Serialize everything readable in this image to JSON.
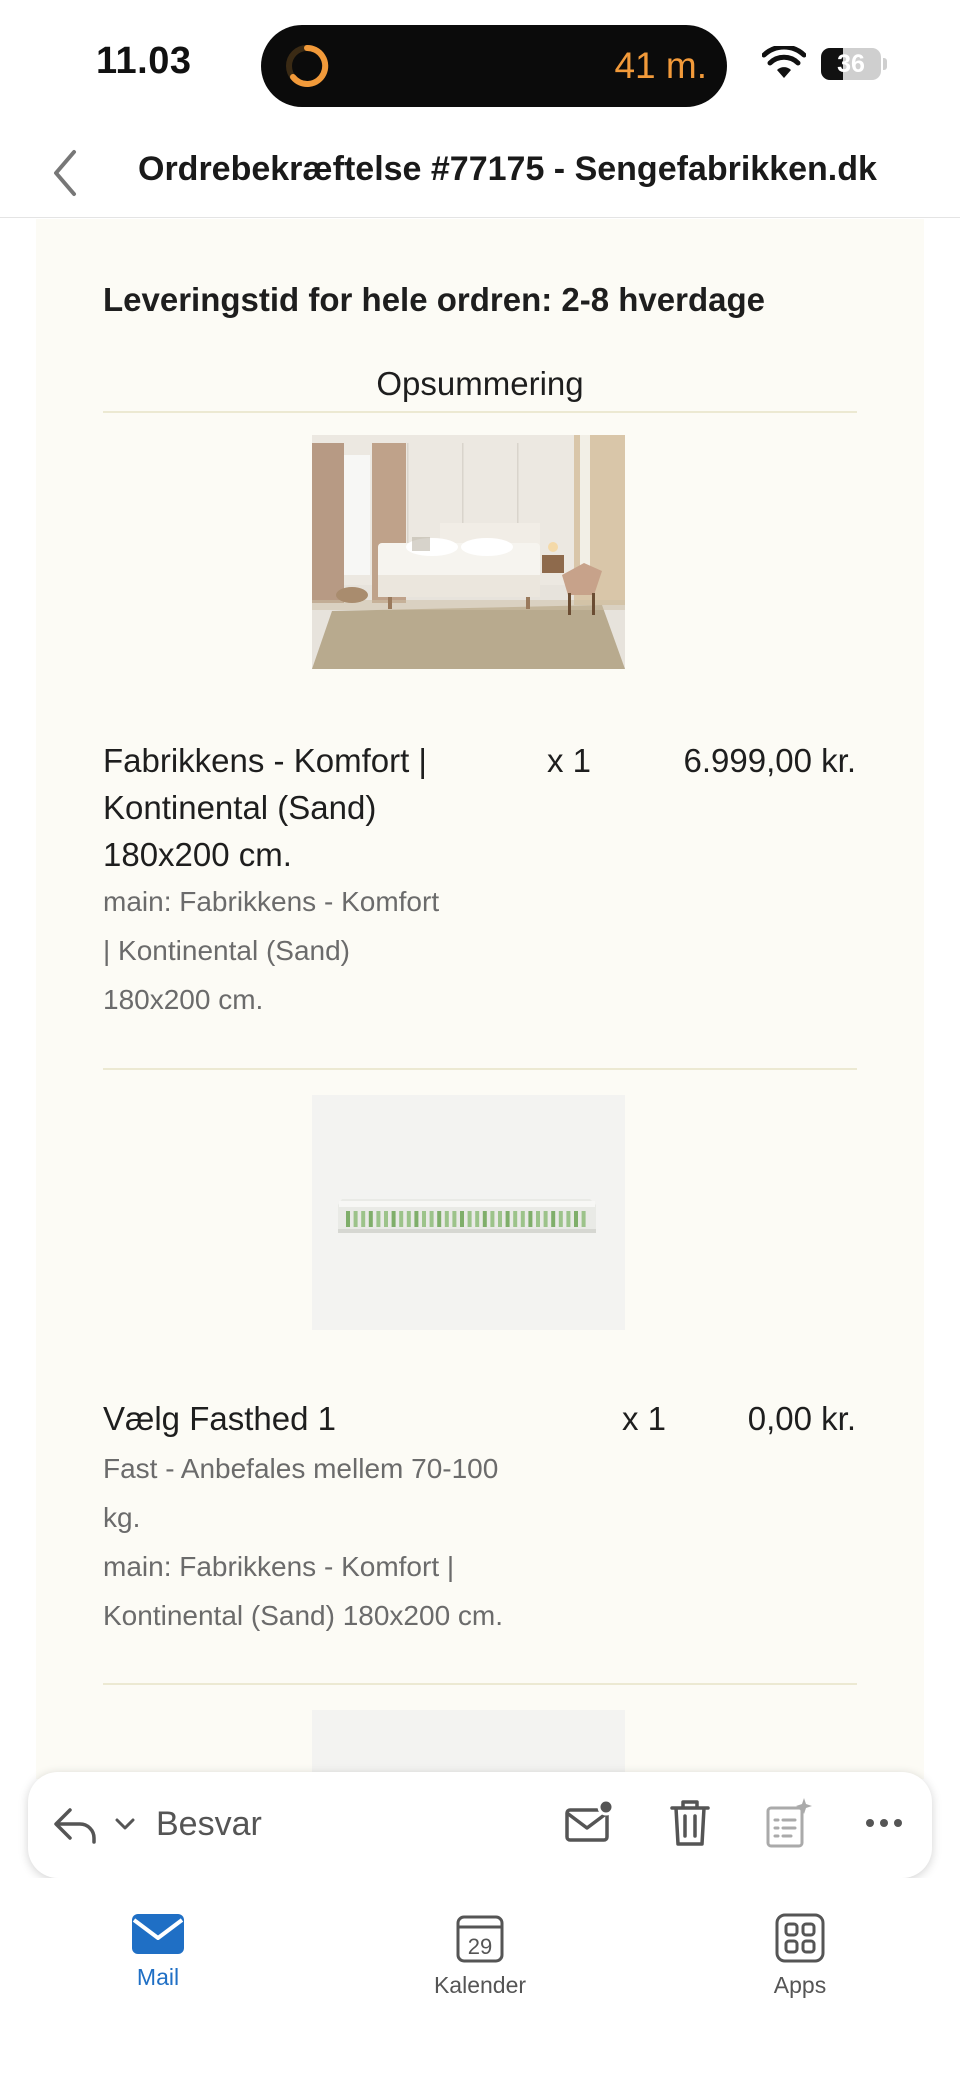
{
  "status_bar": {
    "time": "11.03",
    "eta": "41 m.",
    "battery": "36",
    "battery_level": 0.36,
    "accent": "#f29a3a"
  },
  "nav": {
    "title": "Ordrebekræftelse #77175 - Sengefabrikken.dk",
    "back_icon": "chevron-left-icon"
  },
  "email": {
    "delivery_text": "Leveringstid for hele ordren: 2-8 hverdage",
    "summary_heading": "Opsummering",
    "items": [
      {
        "name_lines": [
          "Fabrikkens - Komfort |",
          "Kontinental (Sand)",
          "180x200 cm."
        ],
        "quantity": "x 1",
        "price": "6.999,00 kr.",
        "meta_lines": [
          "main: Fabrikkens - Komfort",
          "| Kontinental (Sand)",
          "180x200 cm."
        ]
      },
      {
        "name_lines": [
          "Vælg Fasthed 1"
        ],
        "quantity": "x 1",
        "price": "0,00 kr.",
        "meta_lines": [
          "Fast - Anbefales mellem 70-100",
          "kg.",
          "main: Fabrikkens - Komfort |",
          "Kontinental (Sand) 180x200 cm."
        ]
      }
    ]
  },
  "reply_bar": {
    "reply_label": "Besvar",
    "icons": [
      "reply-icon",
      "chevron-down-icon",
      "mark-unread-icon",
      "trash-icon",
      "summarize-icon",
      "more-icon"
    ]
  },
  "tabs": [
    {
      "label": "Mail",
      "icon": "mail-icon",
      "active": true,
      "color": "#1f6fc5"
    },
    {
      "label": "Kalender",
      "icon": "calendar-icon",
      "day": "29",
      "color": "#555555"
    },
    {
      "label": "Apps",
      "icon": "apps-grid-icon",
      "color": "#555555"
    }
  ]
}
